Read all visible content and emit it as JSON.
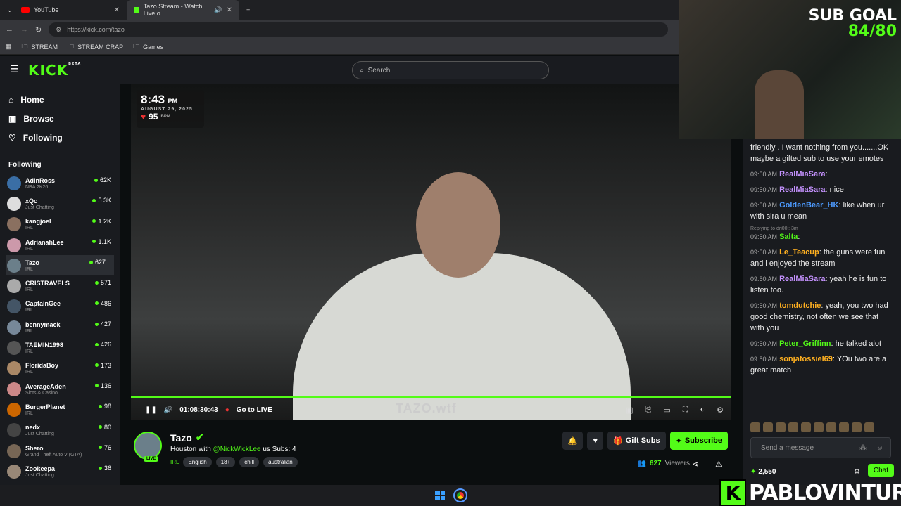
{
  "browser": {
    "tabs": [
      {
        "title": "YouTube"
      },
      {
        "title": "Tazo Stream - Watch Live o"
      }
    ],
    "url": "https://kick.com/tazo",
    "bookmarks": [
      "STREAM",
      "STREAM CRAP",
      "Games"
    ]
  },
  "header": {
    "logo": "KICK",
    "beta": "BETA",
    "search_placeholder": "Search"
  },
  "sidebar": {
    "nav": [
      {
        "label": "Home"
      },
      {
        "label": "Browse"
      },
      {
        "label": "Following"
      }
    ],
    "following_title": "Following",
    "channels": [
      {
        "name": "AdinRoss",
        "category": "NBA 2K26",
        "viewers": "62K"
      },
      {
        "name": "xQc",
        "category": "Just Chatting",
        "viewers": "5.3K"
      },
      {
        "name": "kangjoel",
        "category": "IRL",
        "viewers": "1.2K"
      },
      {
        "name": "AdrianahLee",
        "category": "IRL",
        "viewers": "1.1K"
      },
      {
        "name": "Tazo",
        "category": "IRL",
        "viewers": "627"
      },
      {
        "name": "CRISTRAVELS",
        "category": "IRL",
        "viewers": "571"
      },
      {
        "name": "CaptainGee",
        "category": "IRL",
        "viewers": "486"
      },
      {
        "name": "bennymack",
        "category": "IRL",
        "viewers": "427"
      },
      {
        "name": "TAEMIN1998",
        "category": "IRL",
        "viewers": "426"
      },
      {
        "name": "FloridaBoy",
        "category": "IRL",
        "viewers": "173"
      },
      {
        "name": "AverageAden",
        "category": "Slots & Casino",
        "viewers": "136"
      },
      {
        "name": "BurgerPlanet",
        "category": "IRL",
        "viewers": "98"
      },
      {
        "name": "nedx",
        "category": "Just Chatting",
        "viewers": "80"
      },
      {
        "name": "Shero",
        "category": "Grand Theft Auto V (GTA)",
        "viewers": "76"
      },
      {
        "name": "Zookeepa",
        "category": "Just Chatting",
        "viewers": "36"
      }
    ]
  },
  "player": {
    "overlay_time": "8:43",
    "overlay_ampm": "PM",
    "overlay_date": "AUGUST 29, 2025",
    "bpm": "95",
    "bpm_unit": "BPM",
    "elapsed": "01:08:30:43",
    "go_live": "Go to LIVE",
    "watermark": "TAZO.wtf"
  },
  "stream": {
    "name": "Tazo",
    "live": "LIVE",
    "title_prefix": "Houston with ",
    "mention": "@NickWickLee",
    "title_suffix": " us Subs: 4",
    "category": "IRL",
    "tags": [
      "English",
      "18+",
      "chill",
      "australian"
    ],
    "gift_subs": "Gift Subs",
    "subscribe": "Subscribe",
    "viewers": "627",
    "viewers_label": "Viewers"
  },
  "chat": {
    "messages": [
      {
        "ts": "",
        "user": "",
        "text": "friendly . I want nothing from you.......OK maybe a gifted sub to use your emotes",
        "color": "#eee"
      },
      {
        "ts": "09:50 AM",
        "user": "RealMiaSara",
        "text": "",
        "color": "#c592ff"
      },
      {
        "ts": "09:50 AM",
        "user": "RealMiaSara",
        "text": "nice",
        "color": "#c592ff"
      },
      {
        "ts": "09:50 AM",
        "user": "GoldenBear_HK",
        "text": "like when ur with sira u mean",
        "color": "#4d9bff"
      },
      {
        "ts": "09:50 AM",
        "user": "Salta",
        "text": "",
        "color": "#53fc18",
        "reply": "Replying to dri00l: 3m"
      },
      {
        "ts": "09:50 AM",
        "user": "Le_Teacup",
        "text": "the guns were fun and i enjoyed the stream",
        "color": "#ffb020"
      },
      {
        "ts": "09:50 AM",
        "user": "RealMiaSara",
        "text": "yeah he is fun to listen too.",
        "color": "#c592ff"
      },
      {
        "ts": "09:50 AM",
        "user": "tomdutchie",
        "text": "yeah, you two had good chemistry, not often we see that with you",
        "color": "#ffb020"
      },
      {
        "ts": "09:50 AM",
        "user": "Peter_Griffinn",
        "text": "he talked alot",
        "color": "#53fc18"
      },
      {
        "ts": "09:50 AM",
        "user": "sonjafossiel69",
        "text": "YOu two are a great match",
        "color": "#ffb020"
      }
    ],
    "input_placeholder": "Send a message",
    "points": "2,550",
    "chat_button": "Chat"
  },
  "overlay": {
    "sub_goal": "SUB GOAL",
    "sub_count": "84/80",
    "brand": "PABLOVINTURA",
    "brand_k": "K"
  }
}
